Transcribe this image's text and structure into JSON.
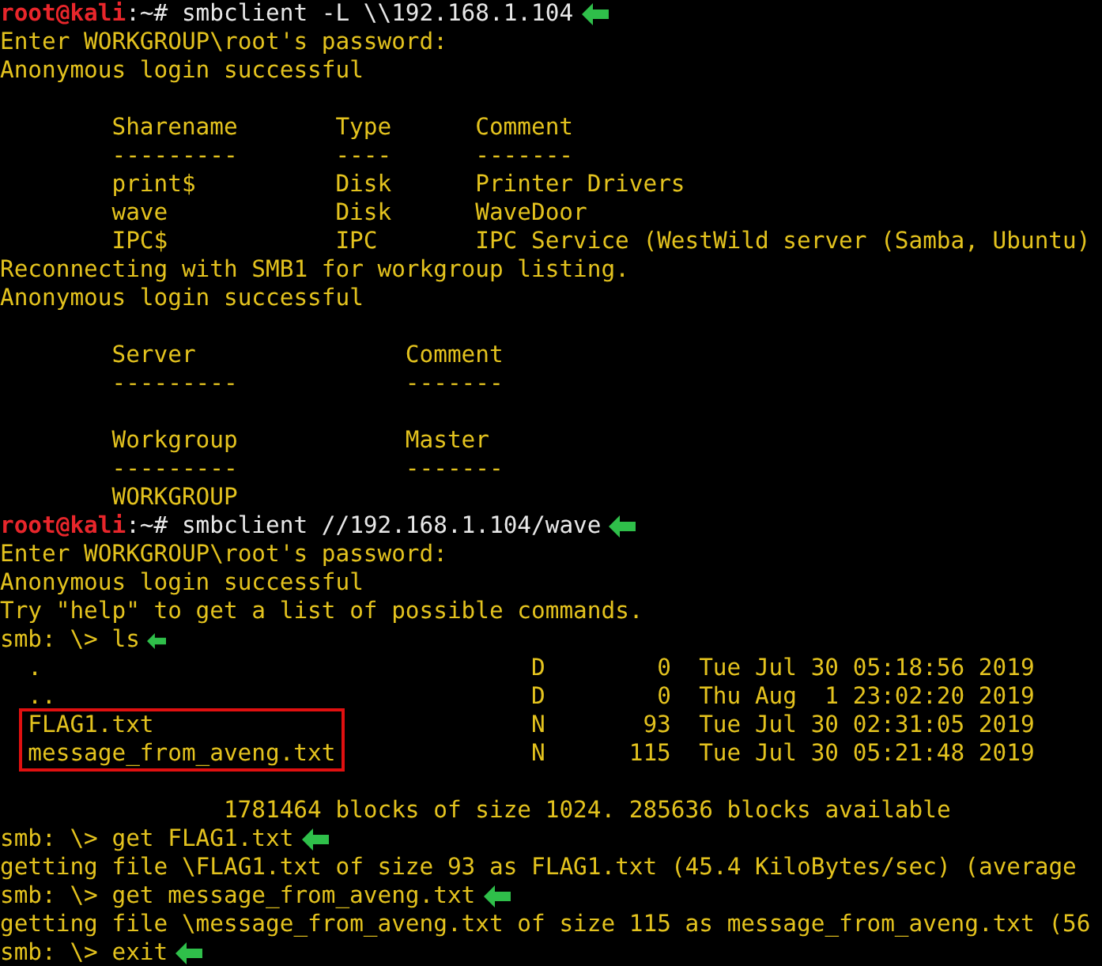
{
  "terminal": {
    "lines": [
      {
        "kind": "prompt",
        "user": "root@kali",
        "path": ":~#",
        "command": "smbclient -L \\\\192.168.1.104",
        "marked": true
      },
      {
        "kind": "text",
        "text": "Enter WORKGROUP\\root's password:"
      },
      {
        "kind": "text",
        "text": "Anonymous login successful"
      },
      {
        "kind": "blank"
      },
      {
        "kind": "share",
        "cells": [
          "Sharename",
          "Type",
          "Comment"
        ]
      },
      {
        "kind": "share",
        "cells": [
          "---------",
          "----",
          "-------"
        ]
      },
      {
        "kind": "share",
        "cells": [
          "print$",
          "Disk",
          "Printer Drivers"
        ]
      },
      {
        "kind": "share",
        "cells": [
          "wave",
          "Disk",
          "WaveDoor"
        ]
      },
      {
        "kind": "share",
        "cells": [
          "IPC$",
          "IPC",
          "IPC Service (WestWild server (Samba, Ubuntu)"
        ]
      },
      {
        "kind": "text",
        "text": "Reconnecting with SMB1 for workgroup listing."
      },
      {
        "kind": "text",
        "text": "Anonymous login successful"
      },
      {
        "kind": "blank"
      },
      {
        "kind": "server",
        "cells": [
          "Server",
          "Comment"
        ]
      },
      {
        "kind": "server",
        "cells": [
          "---------",
          "-------"
        ]
      },
      {
        "kind": "blank"
      },
      {
        "kind": "server",
        "cells": [
          "Workgroup",
          "Master"
        ]
      },
      {
        "kind": "server",
        "cells": [
          "---------",
          "-------"
        ]
      },
      {
        "kind": "server",
        "cells": [
          "WORKGROUP"
        ]
      },
      {
        "kind": "prompt",
        "user": "root@kali",
        "path": ":~#",
        "command": "smbclient //192.168.1.104/wave",
        "marked": true
      },
      {
        "kind": "text",
        "text": "Enter WORKGROUP\\root's password:"
      },
      {
        "kind": "text",
        "text": "Anonymous login successful"
      },
      {
        "kind": "text",
        "text": "Try \"help\" to get a list of possible commands."
      },
      {
        "kind": "smb",
        "prompt": "smb: \\>",
        "command": "ls",
        "marked": true
      },
      {
        "kind": "file",
        "highlighted": false,
        "cells": [
          ".",
          "D",
          "0",
          "Tue Jul 30 05:18:56 2019"
        ]
      },
      {
        "kind": "file",
        "highlighted": false,
        "cells": [
          "..",
          "D",
          "0",
          "Thu Aug  1 23:02:20 2019"
        ]
      },
      {
        "kind": "file",
        "highlighted": true,
        "cells": [
          "FLAG1.txt",
          "N",
          "93",
          "Tue Jul 30 02:31:05 2019"
        ]
      },
      {
        "kind": "file",
        "highlighted": true,
        "cells": [
          "message_from_aveng.txt",
          "N",
          "115",
          "Tue Jul 30 05:21:48 2019"
        ]
      },
      {
        "kind": "blank"
      },
      {
        "kind": "summary",
        "text": "1781464 blocks of size 1024. 285636 blocks available"
      },
      {
        "kind": "smb",
        "prompt": "smb: \\>",
        "command": "get FLAG1.txt",
        "marked": true
      },
      {
        "kind": "text",
        "text": "getting file \\FLAG1.txt of size 93 as FLAG1.txt (45.4 KiloBytes/sec) (average"
      },
      {
        "kind": "smb",
        "prompt": "smb: \\>",
        "command": "get message_from_aveng.txt",
        "marked": true
      },
      {
        "kind": "text",
        "text": "getting file \\message_from_aveng.txt of size 115 as message_from_aveng.txt (56"
      },
      {
        "kind": "smb",
        "prompt": "smb: \\>",
        "command": "exit",
        "marked": true
      }
    ]
  }
}
